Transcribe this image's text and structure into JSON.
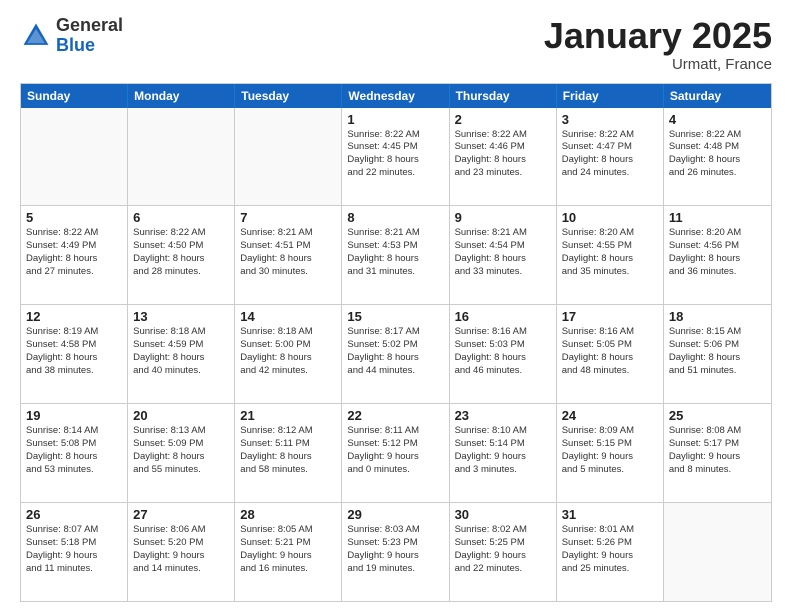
{
  "header": {
    "logo_general": "General",
    "logo_blue": "Blue",
    "month_title": "January 2025",
    "location": "Urmatt, France"
  },
  "weekdays": [
    "Sunday",
    "Monday",
    "Tuesday",
    "Wednesday",
    "Thursday",
    "Friday",
    "Saturday"
  ],
  "weeks": [
    [
      {
        "day": "",
        "sunrise": "",
        "sunset": "",
        "daylight": ""
      },
      {
        "day": "",
        "sunrise": "",
        "sunset": "",
        "daylight": ""
      },
      {
        "day": "",
        "sunrise": "",
        "sunset": "",
        "daylight": ""
      },
      {
        "day": "1",
        "sunrise": "Sunrise: 8:22 AM",
        "sunset": "Sunset: 4:45 PM",
        "daylight": "Daylight: 8 hours and 22 minutes."
      },
      {
        "day": "2",
        "sunrise": "Sunrise: 8:22 AM",
        "sunset": "Sunset: 4:46 PM",
        "daylight": "Daylight: 8 hours and 23 minutes."
      },
      {
        "day": "3",
        "sunrise": "Sunrise: 8:22 AM",
        "sunset": "Sunset: 4:47 PM",
        "daylight": "Daylight: 8 hours and 24 minutes."
      },
      {
        "day": "4",
        "sunrise": "Sunrise: 8:22 AM",
        "sunset": "Sunset: 4:48 PM",
        "daylight": "Daylight: 8 hours and 26 minutes."
      }
    ],
    [
      {
        "day": "5",
        "sunrise": "Sunrise: 8:22 AM",
        "sunset": "Sunset: 4:49 PM",
        "daylight": "Daylight: 8 hours and 27 minutes."
      },
      {
        "day": "6",
        "sunrise": "Sunrise: 8:22 AM",
        "sunset": "Sunset: 4:50 PM",
        "daylight": "Daylight: 8 hours and 28 minutes."
      },
      {
        "day": "7",
        "sunrise": "Sunrise: 8:21 AM",
        "sunset": "Sunset: 4:51 PM",
        "daylight": "Daylight: 8 hours and 30 minutes."
      },
      {
        "day": "8",
        "sunrise": "Sunrise: 8:21 AM",
        "sunset": "Sunset: 4:53 PM",
        "daylight": "Daylight: 8 hours and 31 minutes."
      },
      {
        "day": "9",
        "sunrise": "Sunrise: 8:21 AM",
        "sunset": "Sunset: 4:54 PM",
        "daylight": "Daylight: 8 hours and 33 minutes."
      },
      {
        "day": "10",
        "sunrise": "Sunrise: 8:20 AM",
        "sunset": "Sunset: 4:55 PM",
        "daylight": "Daylight: 8 hours and 35 minutes."
      },
      {
        "day": "11",
        "sunrise": "Sunrise: 8:20 AM",
        "sunset": "Sunset: 4:56 PM",
        "daylight": "Daylight: 8 hours and 36 minutes."
      }
    ],
    [
      {
        "day": "12",
        "sunrise": "Sunrise: 8:19 AM",
        "sunset": "Sunset: 4:58 PM",
        "daylight": "Daylight: 8 hours and 38 minutes."
      },
      {
        "day": "13",
        "sunrise": "Sunrise: 8:18 AM",
        "sunset": "Sunset: 4:59 PM",
        "daylight": "Daylight: 8 hours and 40 minutes."
      },
      {
        "day": "14",
        "sunrise": "Sunrise: 8:18 AM",
        "sunset": "Sunset: 5:00 PM",
        "daylight": "Daylight: 8 hours and 42 minutes."
      },
      {
        "day": "15",
        "sunrise": "Sunrise: 8:17 AM",
        "sunset": "Sunset: 5:02 PM",
        "daylight": "Daylight: 8 hours and 44 minutes."
      },
      {
        "day": "16",
        "sunrise": "Sunrise: 8:16 AM",
        "sunset": "Sunset: 5:03 PM",
        "daylight": "Daylight: 8 hours and 46 minutes."
      },
      {
        "day": "17",
        "sunrise": "Sunrise: 8:16 AM",
        "sunset": "Sunset: 5:05 PM",
        "daylight": "Daylight: 8 hours and 48 minutes."
      },
      {
        "day": "18",
        "sunrise": "Sunrise: 8:15 AM",
        "sunset": "Sunset: 5:06 PM",
        "daylight": "Daylight: 8 hours and 51 minutes."
      }
    ],
    [
      {
        "day": "19",
        "sunrise": "Sunrise: 8:14 AM",
        "sunset": "Sunset: 5:08 PM",
        "daylight": "Daylight: 8 hours and 53 minutes."
      },
      {
        "day": "20",
        "sunrise": "Sunrise: 8:13 AM",
        "sunset": "Sunset: 5:09 PM",
        "daylight": "Daylight: 8 hours and 55 minutes."
      },
      {
        "day": "21",
        "sunrise": "Sunrise: 8:12 AM",
        "sunset": "Sunset: 5:11 PM",
        "daylight": "Daylight: 8 hours and 58 minutes."
      },
      {
        "day": "22",
        "sunrise": "Sunrise: 8:11 AM",
        "sunset": "Sunset: 5:12 PM",
        "daylight": "Daylight: 9 hours and 0 minutes."
      },
      {
        "day": "23",
        "sunrise": "Sunrise: 8:10 AM",
        "sunset": "Sunset: 5:14 PM",
        "daylight": "Daylight: 9 hours and 3 minutes."
      },
      {
        "day": "24",
        "sunrise": "Sunrise: 8:09 AM",
        "sunset": "Sunset: 5:15 PM",
        "daylight": "Daylight: 9 hours and 5 minutes."
      },
      {
        "day": "25",
        "sunrise": "Sunrise: 8:08 AM",
        "sunset": "Sunset: 5:17 PM",
        "daylight": "Daylight: 9 hours and 8 minutes."
      }
    ],
    [
      {
        "day": "26",
        "sunrise": "Sunrise: 8:07 AM",
        "sunset": "Sunset: 5:18 PM",
        "daylight": "Daylight: 9 hours and 11 minutes."
      },
      {
        "day": "27",
        "sunrise": "Sunrise: 8:06 AM",
        "sunset": "Sunset: 5:20 PM",
        "daylight": "Daylight: 9 hours and 14 minutes."
      },
      {
        "day": "28",
        "sunrise": "Sunrise: 8:05 AM",
        "sunset": "Sunset: 5:21 PM",
        "daylight": "Daylight: 9 hours and 16 minutes."
      },
      {
        "day": "29",
        "sunrise": "Sunrise: 8:03 AM",
        "sunset": "Sunset: 5:23 PM",
        "daylight": "Daylight: 9 hours and 19 minutes."
      },
      {
        "day": "30",
        "sunrise": "Sunrise: 8:02 AM",
        "sunset": "Sunset: 5:25 PM",
        "daylight": "Daylight: 9 hours and 22 minutes."
      },
      {
        "day": "31",
        "sunrise": "Sunrise: 8:01 AM",
        "sunset": "Sunset: 5:26 PM",
        "daylight": "Daylight: 9 hours and 25 minutes."
      },
      {
        "day": "",
        "sunrise": "",
        "sunset": "",
        "daylight": ""
      }
    ]
  ]
}
